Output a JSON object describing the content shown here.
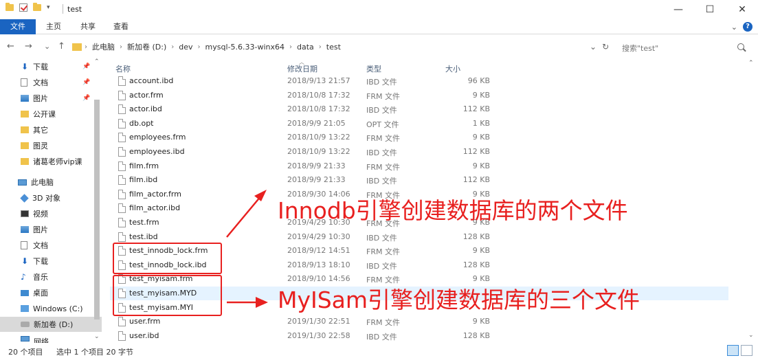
{
  "window": {
    "title": "test",
    "min_glyph": "—",
    "max_glyph": "☐",
    "close_glyph": "✕"
  },
  "quick_access": {
    "dropdown_glyph": "▾"
  },
  "ribbon": {
    "tabs": [
      "文件",
      "主页",
      "共享",
      "查看"
    ],
    "expand_glyph": "⌄",
    "help_glyph": "?"
  },
  "nav": {
    "back_glyph": "←",
    "forward_glyph": "→",
    "recent_glyph": "⌄",
    "up_glyph": "↑",
    "breadcrumb": [
      "此电脑",
      "新加卷 (D:)",
      "dev",
      "mysql-5.6.33-winx64",
      "data",
      "test"
    ],
    "separator": "›",
    "dropdown_glyph": "⌄",
    "refresh_glyph": "↻"
  },
  "search": {
    "placeholder": "搜索\"test\""
  },
  "sidebar": {
    "items": [
      {
        "label": "下载",
        "icon": "download-icon",
        "pinned": true
      },
      {
        "label": "文档",
        "icon": "document-icon",
        "pinned": true
      },
      {
        "label": "图片",
        "icon": "picture-icon",
        "pinned": true
      },
      {
        "label": "公开课",
        "icon": "folder-icon",
        "pinned": false
      },
      {
        "label": "其它",
        "icon": "folder-icon",
        "pinned": false
      },
      {
        "label": "图灵",
        "icon": "folder-icon",
        "pinned": false
      },
      {
        "label": "诸葛老师vip课",
        "icon": "folder-icon",
        "pinned": false
      },
      {
        "label": "此电脑",
        "icon": "computer-icon",
        "pinned": false
      },
      {
        "label": "3D 对象",
        "icon": "3d-objects-icon",
        "pinned": false
      },
      {
        "label": "视频",
        "icon": "video-icon",
        "pinned": false
      },
      {
        "label": "图片",
        "icon": "picture-icon",
        "pinned": false
      },
      {
        "label": "文档",
        "icon": "document-icon",
        "pinned": false
      },
      {
        "label": "下载",
        "icon": "download-icon",
        "pinned": false
      },
      {
        "label": "音乐",
        "icon": "music-icon",
        "pinned": false
      },
      {
        "label": "桌面",
        "icon": "desktop-icon",
        "pinned": false
      },
      {
        "label": "Windows (C:)",
        "icon": "windows-drive-icon",
        "pinned": false
      },
      {
        "label": "新加卷 (D:)",
        "icon": "drive-icon",
        "pinned": false,
        "selected": true
      },
      {
        "label": "网络",
        "icon": "network-icon",
        "pinned": false
      }
    ],
    "pin_glyph": "📌"
  },
  "columns": {
    "name": "名称",
    "date": "修改日期",
    "type": "类型",
    "size": "大小"
  },
  "files": [
    {
      "name": "account.ibd",
      "date": "2018/9/13 21:57",
      "type": "IBD 文件",
      "size": "96 KB"
    },
    {
      "name": "actor.frm",
      "date": "2018/10/8 17:32",
      "type": "FRM 文件",
      "size": "9 KB"
    },
    {
      "name": "actor.ibd",
      "date": "2018/10/8 17:32",
      "type": "IBD 文件",
      "size": "112 KB"
    },
    {
      "name": "db.opt",
      "date": "2018/9/9 21:05",
      "type": "OPT 文件",
      "size": "1 KB"
    },
    {
      "name": "employees.frm",
      "date": "2018/10/9 13:22",
      "type": "FRM 文件",
      "size": "9 KB"
    },
    {
      "name": "employees.ibd",
      "date": "2018/10/9 13:22",
      "type": "IBD 文件",
      "size": "112 KB"
    },
    {
      "name": "film.frm",
      "date": "2018/9/9 21:33",
      "type": "FRM 文件",
      "size": "9 KB"
    },
    {
      "name": "film.ibd",
      "date": "2018/9/9 21:33",
      "type": "IBD 文件",
      "size": "112 KB"
    },
    {
      "name": "film_actor.frm",
      "date": "2018/9/30 14:06",
      "type": "FRM 文件",
      "size": "9 KB"
    },
    {
      "name": "film_actor.ibd",
      "date": "",
      "type": "",
      "size": ""
    },
    {
      "name": "test.frm",
      "date": "2019/4/29 10:30",
      "type": "FRM 文件",
      "size": "9 KB"
    },
    {
      "name": "test.ibd",
      "date": "2019/4/29 10:30",
      "type": "IBD 文件",
      "size": "128 KB"
    },
    {
      "name": "test_innodb_lock.frm",
      "date": "2018/9/12 14:51",
      "type": "FRM 文件",
      "size": "9 KB"
    },
    {
      "name": "test_innodb_lock.ibd",
      "date": "2018/9/13 18:10",
      "type": "IBD 文件",
      "size": "128 KB"
    },
    {
      "name": "test_myisam.frm",
      "date": "2018/9/10 14:56",
      "type": "FRM 文件",
      "size": "9 KB"
    },
    {
      "name": "test_myisam.MYD",
      "date": "",
      "type": "",
      "size": ""
    },
    {
      "name": "test_myisam.MYI",
      "date": "",
      "type": "",
      "size": ""
    },
    {
      "name": "user.frm",
      "date": "2019/1/30 22:51",
      "type": "FRM 文件",
      "size": "9 KB"
    },
    {
      "name": "user.ibd",
      "date": "2019/1/30 22:58",
      "type": "IBD 文件",
      "size": "128 KB"
    }
  ],
  "status": {
    "count": "20 个项目",
    "selection": "选中 1 个项目 20 字节"
  },
  "annotations": {
    "innodb": "Innodb引擎创建数据库的两个文件",
    "myisam": "MyISam引擎创建数据库的三个文件",
    "color": "#e8201f"
  }
}
